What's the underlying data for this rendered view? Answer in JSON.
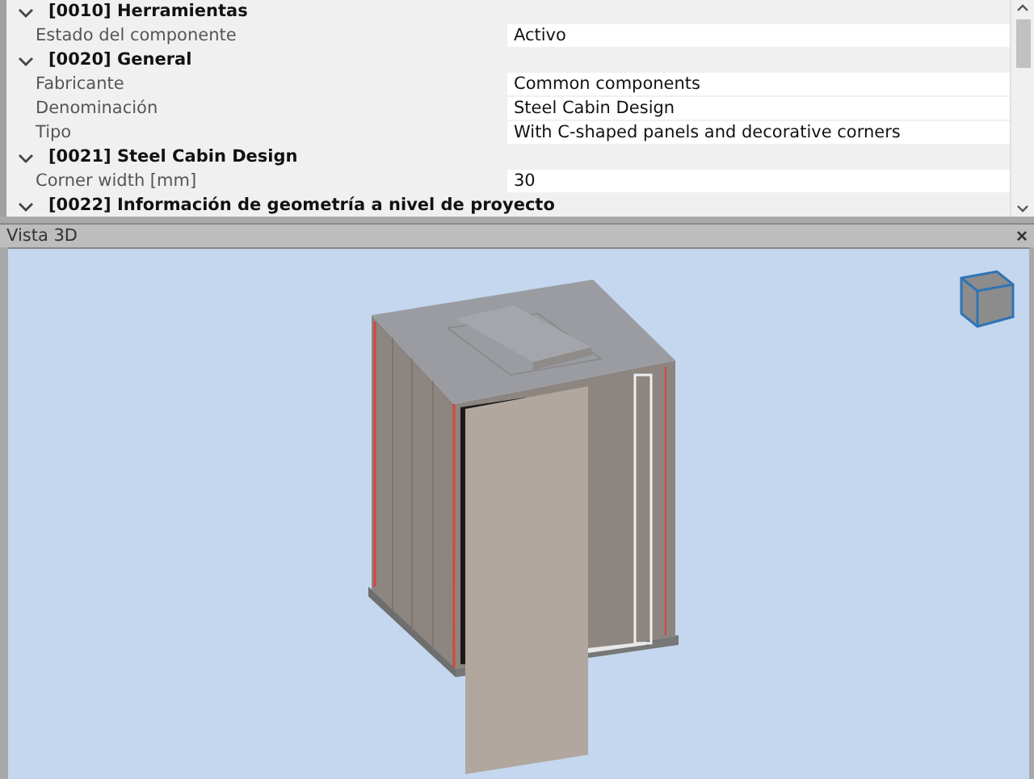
{
  "property_grid": {
    "groups": [
      {
        "title": "[0010] Herramientas",
        "expanded": true,
        "properties": [
          {
            "name": "Estado del componente",
            "value": "Activo"
          }
        ]
      },
      {
        "title": "[0020] General",
        "expanded": true,
        "properties": [
          {
            "name": "Fabricante",
            "value": "Common components"
          },
          {
            "name": "Denominación",
            "value": "Steel Cabin Design"
          },
          {
            "name": "Tipo",
            "value": "With C-shaped panels and decorative corners"
          }
        ]
      },
      {
        "title": "[0021] Steel Cabin Design",
        "expanded": true,
        "properties": [
          {
            "name": "Corner width [mm]",
            "value": "30"
          }
        ]
      },
      {
        "title": "[0022] Información de geometría a nivel de proyecto",
        "expanded": true
      }
    ]
  },
  "view_panel": {
    "title": "Vista 3D",
    "close": "×"
  }
}
